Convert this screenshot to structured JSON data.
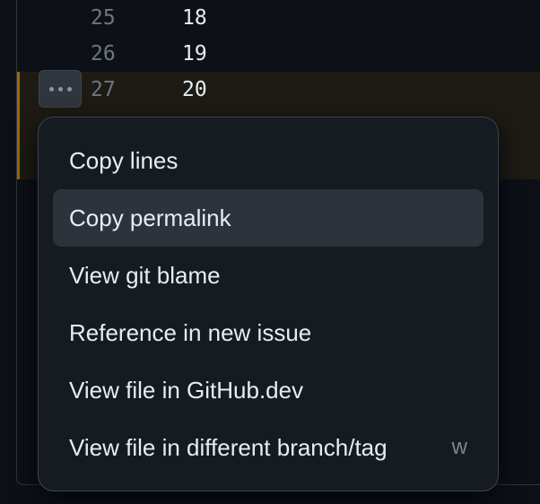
{
  "code": {
    "lines": [
      {
        "num": "25",
        "text": "18"
      },
      {
        "num": "26",
        "text": "19"
      },
      {
        "num": "27",
        "text": "20"
      }
    ]
  },
  "line_menu": {
    "trigger_icon": "kebab-horizontal-icon",
    "items": [
      {
        "label": "Copy lines",
        "shortcut": ""
      },
      {
        "label": "Copy permalink",
        "shortcut": ""
      },
      {
        "label": "View git blame",
        "shortcut": ""
      },
      {
        "label": "Reference in new issue",
        "shortcut": ""
      },
      {
        "label": "View file in GitHub.dev",
        "shortcut": ""
      },
      {
        "label": "View file in different branch/tag",
        "shortcut": "w"
      }
    ],
    "active_index": 1
  },
  "colors": {
    "background": "#0d1117",
    "menu_background": "#161b22",
    "menu_hover": "#2d333b",
    "highlight_bar": "#9e6a03",
    "text": "#e6edf3",
    "muted": "#6e7681"
  }
}
